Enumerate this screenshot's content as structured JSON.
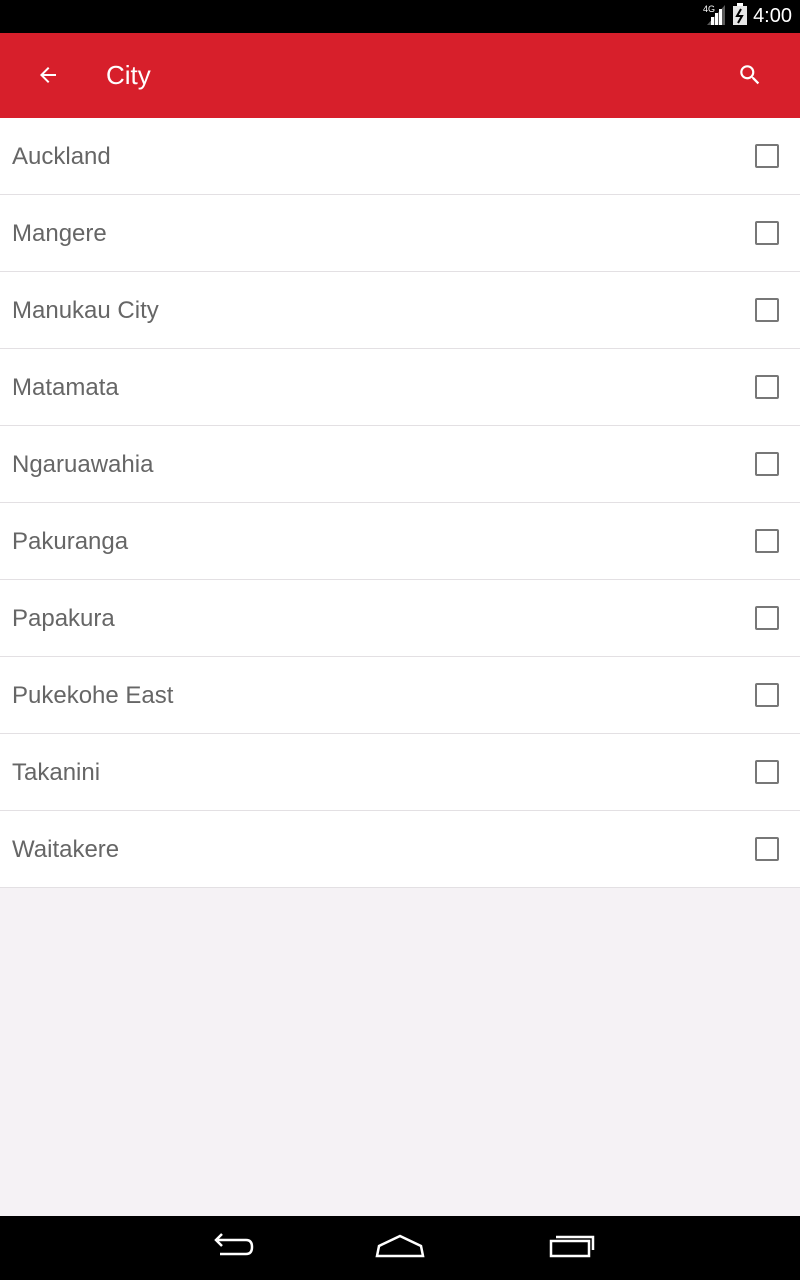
{
  "status_bar": {
    "network": "4G",
    "time": "4:00"
  },
  "app_bar": {
    "title": "City",
    "back_icon": "arrow-back-icon",
    "search_icon": "search-icon",
    "color": "#d71f2b"
  },
  "cities": [
    {
      "label": "Auckland",
      "checked": false
    },
    {
      "label": "Mangere",
      "checked": false
    },
    {
      "label": "Manukau City",
      "checked": false
    },
    {
      "label": "Matamata",
      "checked": false
    },
    {
      "label": "Ngaruawahia",
      "checked": false
    },
    {
      "label": "Pakuranga",
      "checked": false
    },
    {
      "label": "Papakura",
      "checked": false
    },
    {
      "label": "Pukekohe East",
      "checked": false
    },
    {
      "label": "Takanini",
      "checked": false
    },
    {
      "label": "Waitakere",
      "checked": false
    }
  ],
  "nav_bar": {
    "icons": [
      "back-icon",
      "home-icon",
      "recents-icon"
    ]
  }
}
